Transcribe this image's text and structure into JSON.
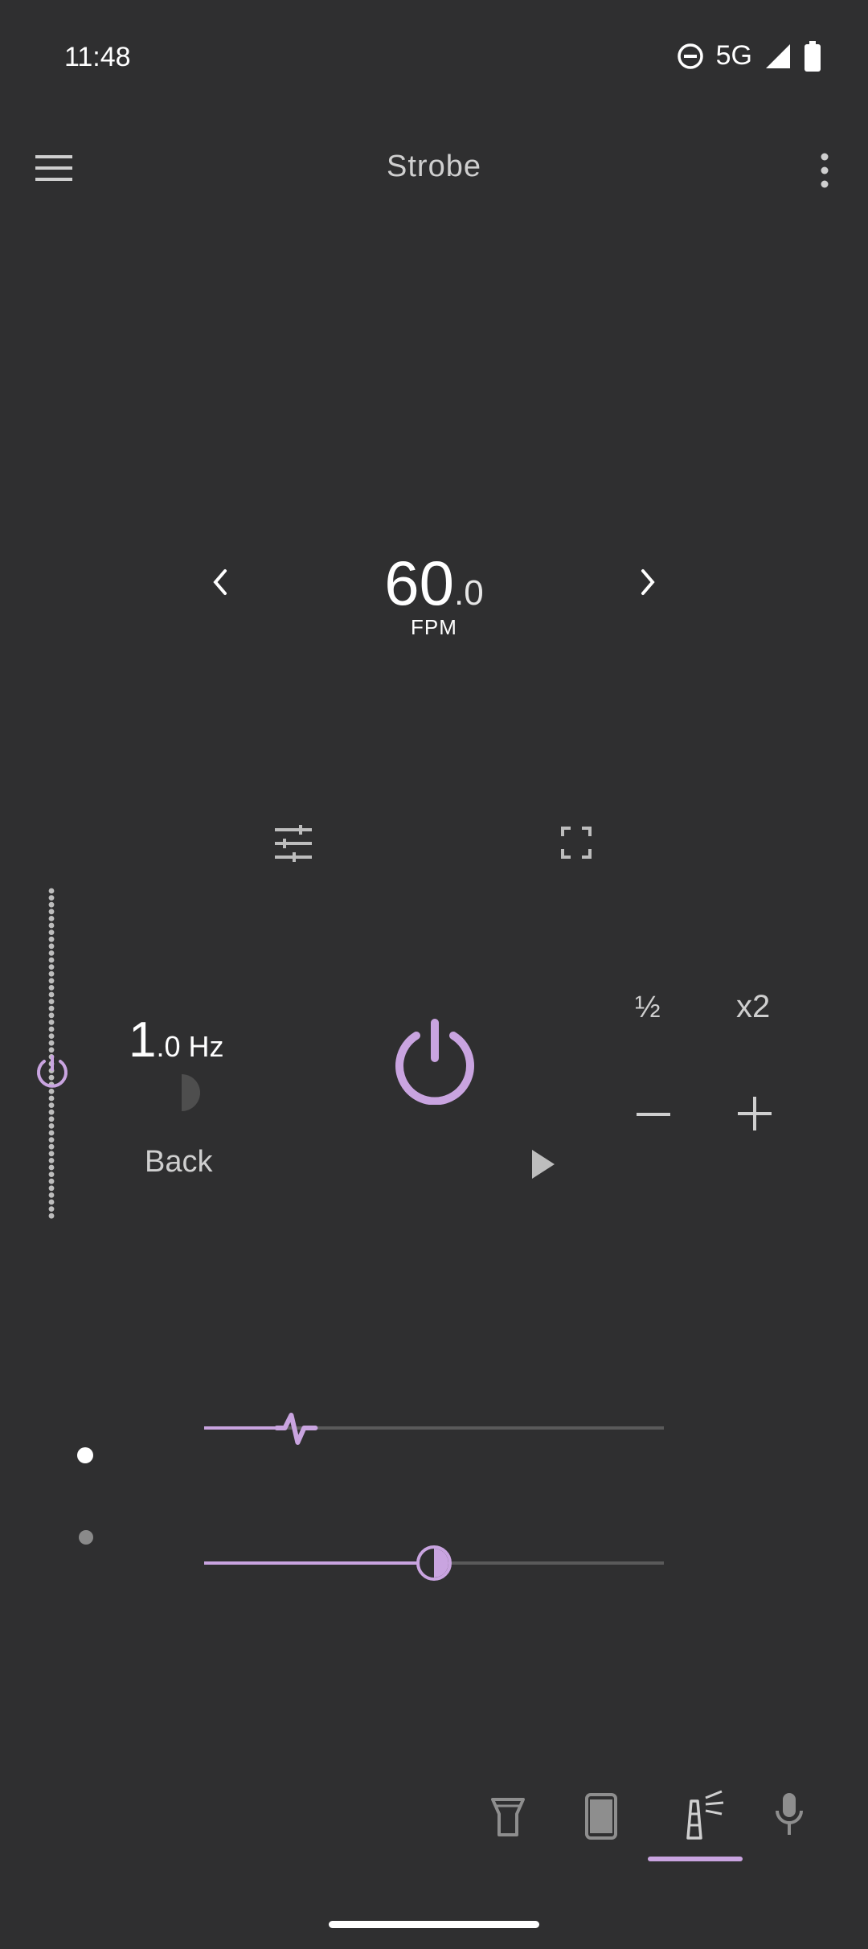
{
  "status": {
    "time": "11:48",
    "network": "5G"
  },
  "app": {
    "title": "Strobe"
  },
  "fpm": {
    "whole": "60",
    "decimal": ".0",
    "unit": "FPM"
  },
  "frequency": {
    "whole": "1",
    "decimal": ".0",
    "unit": "Hz"
  },
  "controls": {
    "back_label": "Back",
    "half_label": "½",
    "double_label": "x2"
  },
  "sliders": {
    "waveform_fraction": 0.2,
    "duty_fraction": 0.5
  },
  "bottom_nav": {
    "items": [
      "flashlight-icon",
      "screen-icon",
      "strobe-icon",
      "microphone-icon"
    ],
    "selected": "strobe-icon"
  },
  "colors": {
    "background": "#2f2f30",
    "accent": "#c9a4e0",
    "icon": "#bdbdbd"
  }
}
